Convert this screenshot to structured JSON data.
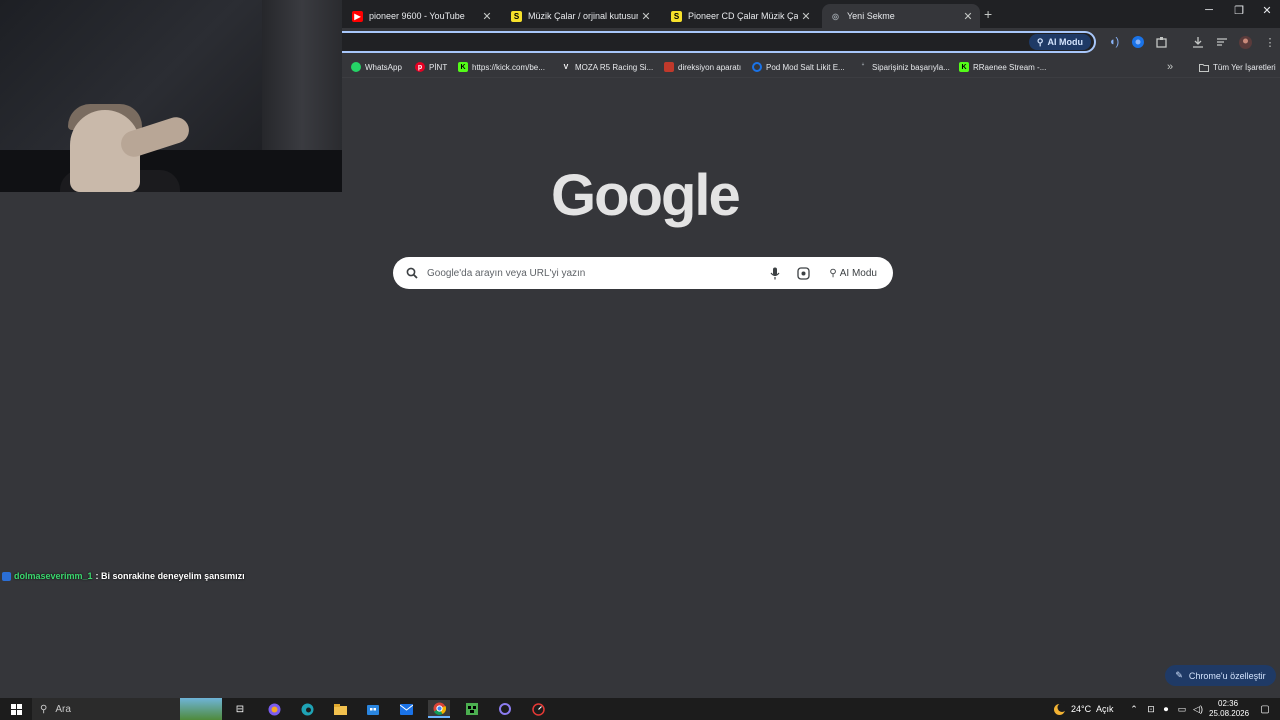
{
  "tabs": [
    {
      "label": "pioneer 9600 - YouTube",
      "favicon": "youtube-icon",
      "color": "#ff0000",
      "glyph": "▶"
    },
    {
      "label": "Müzik Çalar / orjinal kutusunda",
      "favicon": "s-site-icon",
      "color": "#f7e12b",
      "glyph": "S"
    },
    {
      "label": "Pioneer CD Çalar Müzik Çalar O",
      "favicon": "s-site-icon",
      "color": "#f7e12b",
      "glyph": "S"
    },
    {
      "label": "Yeni Sekme",
      "favicon": "chrome-newtab-icon",
      "color": "#9aa0a6",
      "glyph": "◎"
    }
  ],
  "tab_close": "✕",
  "new_tab": "+",
  "window_controls": {
    "minimize": "─",
    "restore": "❐",
    "close": "✕"
  },
  "omnibox": {
    "ai_mode_label": "AI Modu"
  },
  "bookmarks": [
    {
      "label": "WhatsApp",
      "icon": "whatsapp-icon",
      "color": "#25d366"
    },
    {
      "label": "PİNT",
      "icon": "pinterest-icon",
      "color": "#e60023"
    },
    {
      "label": "https://kick.com/be...",
      "icon": "kick-icon",
      "color": "#53fc18"
    },
    {
      "label": "MOZA R5 Racing Si...",
      "icon": "moza-icon",
      "color": "#ffffff"
    },
    {
      "label": "direksiyon aparatı",
      "icon": "shop-icon",
      "color": "#c0392b"
    },
    {
      "label": "Pod Mod Salt Likit E...",
      "icon": "refresh-site-icon",
      "color": "#1a73e8"
    },
    {
      "label": "Siparişiniz başarıyla...",
      "icon": "order-icon",
      "color": "#9aa0a6"
    },
    {
      "label": "RRaenee Stream -...",
      "icon": "kick-icon",
      "color": "#53fc18"
    }
  ],
  "bookmarks_more": "»",
  "all_bookmarks": "Tüm Yer İşaretleri",
  "google_logo": "Google",
  "search": {
    "placeholder": "Google'da arayın veya URL'yi yazın",
    "ai_mode_label": "AI Modu"
  },
  "chat": {
    "user": "dolmaseverimm_1",
    "message": ": Bi sonrakine deneyelim şansımızı"
  },
  "customize_label": "Chrome'u özelleştir",
  "taskbar": {
    "search_label": "Ara",
    "weather": "24°C",
    "weather_desc": "Açık",
    "time": "02:36",
    "date": "25.08.2026"
  }
}
